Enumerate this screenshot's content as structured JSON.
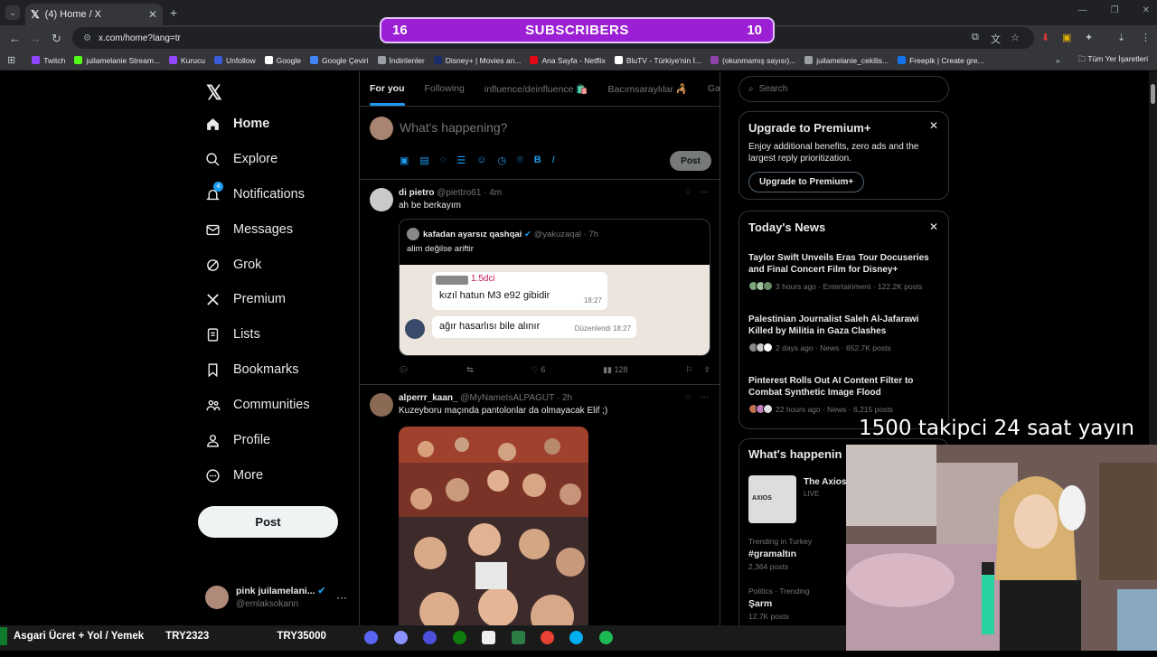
{
  "browser": {
    "tab_title": "(4) Home / X",
    "url": "x.com/home?lang=tr",
    "bookmarks": [
      {
        "label": "Twitch",
        "color": "#9146ff"
      },
      {
        "label": "juilamelanie Stream...",
        "color": "#53fc18"
      },
      {
        "label": "Kurucu",
        "color": "#9146ff"
      },
      {
        "label": "Unfollow",
        "color": "#3b5bdb"
      },
      {
        "label": "Google",
        "color": "#ffffff"
      },
      {
        "label": "Google Çeviri",
        "color": "#4285f4"
      },
      {
        "label": "İndirilenler",
        "color": "#9aa0a6"
      },
      {
        "label": "Disney+ | Movies an...",
        "color": "#1b2b6b"
      },
      {
        "label": "Ana Sayfa - Netflix",
        "color": "#e50914"
      },
      {
        "label": "BluTV - Türkiye'nin İ...",
        "color": "#ffffff"
      },
      {
        "label": "(okunmamış sayısı)...",
        "color": "#8e44ad"
      },
      {
        "label": "juilamelanie_cekilis...",
        "color": "#9aa0a6"
      },
      {
        "label": "Freepik | Create gre...",
        "color": "#1273eb"
      }
    ],
    "all_bookmarks": "Tüm Yer İşaretleri"
  },
  "subscriber_bar": {
    "left": "16",
    "label": "SUBSCRIBERS",
    "right": "10"
  },
  "nav": {
    "items": [
      {
        "label": "Home",
        "icon": "home-icon"
      },
      {
        "label": "Explore",
        "icon": "search-icon"
      },
      {
        "label": "Notifications",
        "icon": "bell-icon",
        "badge": "4"
      },
      {
        "label": "Messages",
        "icon": "mail-icon"
      },
      {
        "label": "Grok",
        "icon": "grok-icon"
      },
      {
        "label": "Premium",
        "icon": "x-icon"
      },
      {
        "label": "Lists",
        "icon": "list-icon"
      },
      {
        "label": "Bookmarks",
        "icon": "bookmark-icon"
      },
      {
        "label": "Communities",
        "icon": "people-icon"
      },
      {
        "label": "Profile",
        "icon": "person-icon"
      },
      {
        "label": "More",
        "icon": "more-circle-icon"
      }
    ],
    "post_label": "Post",
    "user": {
      "name": "pink juilamelani...",
      "handle": "@emlaksokann"
    }
  },
  "tabs": [
    "For you",
    "Following",
    "influence/deinfluence 🛍️",
    "Bacımsaraylılar 🦂",
    "Gala"
  ],
  "composer": {
    "placeholder": "What's happening?",
    "post_label": "Post"
  },
  "tweets": [
    {
      "name": "di pietro",
      "handle": "@piettro61 · 4m",
      "text": "ah be berkayım",
      "quote": {
        "name": "kafadan ayarsız qashqai",
        "handle": "@yakuzaqal · 7h",
        "text": "alim değilse ariftir",
        "chat": {
          "sender": "1.5dci",
          "msg1": "kızıl hatun M3 e92 gibidir",
          "time1": "18:27",
          "msg2": "ağır hasarlısı bile alınır",
          "edited": "Düzenlendi 18:27"
        }
      },
      "stats": {
        "replies": "",
        "retweets": "",
        "likes": "6",
        "views": "128"
      }
    },
    {
      "name": "alperrr_kaan_",
      "handle": "@MyNameIsALPAGUT · 2h",
      "text": "Kuzeyboru maçında pantolonlar da olmayacak Elif ;)"
    }
  ],
  "right": {
    "search_placeholder": "Search",
    "premium": {
      "title": "Upgrade to Premium+",
      "body": "Enjoy additional benefits, zero ads and the largest reply prioritization.",
      "button": "Upgrade to Premium+"
    },
    "news": {
      "title": "Today's News",
      "items": [
        {
          "headline": "Taylor Swift Unveils Eras Tour Docuseries and Final Concert Film for Disney+",
          "meta": "3 hours ago · Entertainment · 122.2K posts"
        },
        {
          "headline": "Palestinian Journalist Saleh Al-Jafarawi Killed by Militia in Gaza Clashes",
          "meta": "2 days ago · News · 652.7K posts"
        },
        {
          "headline": "Pinterest Rolls Out AI Content Filter to Combat Synthetic Image Flood",
          "meta": "22 hours ago · News · 6,215 posts"
        }
      ]
    },
    "happening": {
      "title": "What's happenin",
      "live_title": "The Axios",
      "live_badge": "LIVE",
      "trends": [
        {
          "context": "Trending in Turkey",
          "name": "#gramaltın",
          "posts": "2,364 posts"
        },
        {
          "context": "Politics · Trending",
          "name": "Şarm",
          "posts": "12.7K posts"
        }
      ]
    }
  },
  "stream": {
    "overlay": "1500 takipci 24 saat yayın",
    "ticker_title": "Asgari Ücret + Yol / Yemek",
    "ticker_v1": "TRY2323",
    "ticker_v2": "TRY35000"
  },
  "colors": {
    "accent": "#1d9bf0",
    "subscriber_bar": "#9b1fd4",
    "like": "#f91880"
  }
}
